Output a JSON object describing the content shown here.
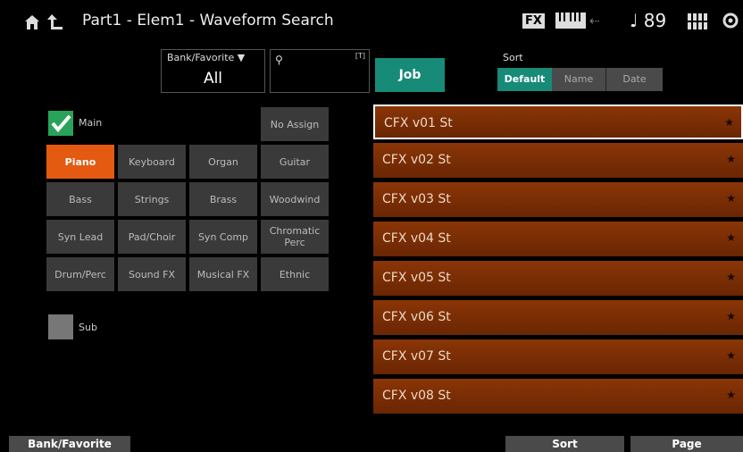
{
  "header": {
    "title": "Part1 - Elem1 - Waveform Search",
    "fx_badge": "FX",
    "tempo": "♩ 89"
  },
  "bank_favorite": {
    "label": "Bank/Favorite",
    "value": "All"
  },
  "search": {
    "placeholder": ""
  },
  "job_label": "Job",
  "sort": {
    "label": "Sort",
    "options": [
      "Default",
      "Name",
      "Date"
    ],
    "selected": "Default"
  },
  "main_checkbox": {
    "label": "Main",
    "checked": true
  },
  "sub_checkbox": {
    "label": "Sub",
    "checked": false
  },
  "categories": [
    "No Assign",
    "Piano",
    "Keyboard",
    "Organ",
    "Guitar",
    "Bass",
    "Strings",
    "Brass",
    "Woodwind",
    "Syn Lead",
    "Pad/Choir",
    "Syn Comp",
    "Chromatic Perc",
    "Drum/Perc",
    "Sound FX",
    "Musical FX",
    "Ethnic"
  ],
  "selected_category": "Piano",
  "waveforms": [
    "CFX v01 St",
    "CFX v02 St",
    "CFX v03 St",
    "CFX v04 St",
    "CFX v05 St",
    "CFX v06 St",
    "CFX v07 St",
    "CFX v08 St"
  ],
  "bottom": {
    "bank_favorite": "Bank/Favorite",
    "sort": "Sort",
    "page": "Page"
  },
  "colors": {
    "accent": "#178a78",
    "selected_category": "#e45a10",
    "list_row": "#7a2e05",
    "checkbox": "#2aa35a"
  }
}
